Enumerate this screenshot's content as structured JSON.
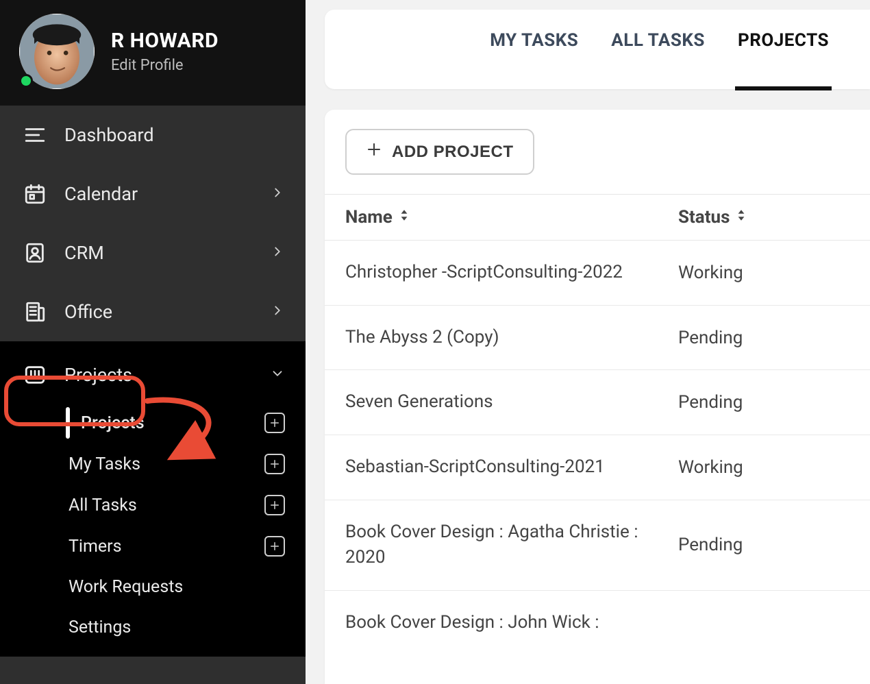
{
  "profile": {
    "name": "R HOWARD",
    "edit_label": "Edit Profile"
  },
  "sidebar": {
    "items": [
      {
        "label": "Dashboard"
      },
      {
        "label": "Calendar"
      },
      {
        "label": "CRM"
      },
      {
        "label": "Office"
      },
      {
        "label": "Projects"
      }
    ],
    "projects_sub": [
      {
        "label": "Projects",
        "has_add": true,
        "active": true
      },
      {
        "label": "My Tasks",
        "has_add": true
      },
      {
        "label": "All Tasks",
        "has_add": true
      },
      {
        "label": "Timers",
        "has_add": true
      },
      {
        "label": "Work Requests",
        "has_add": false
      },
      {
        "label": "Settings",
        "has_add": false
      }
    ]
  },
  "tabs": {
    "my_tasks": "MY TASKS",
    "all_tasks": "ALL TASKS",
    "projects": "PROJECTS"
  },
  "toolbar": {
    "add_project": "ADD PROJECT"
  },
  "table": {
    "headers": {
      "name": "Name",
      "status": "Status"
    },
    "rows": [
      {
        "name": "Christopher -ScriptConsulting-2022",
        "status": "Working"
      },
      {
        "name": "The Abyss 2 (Copy)",
        "status": "Pending"
      },
      {
        "name": "Seven Generations",
        "status": "Pending"
      },
      {
        "name": "Sebastian-ScriptConsulting-2021",
        "status": "Working"
      },
      {
        "name": "Book Cover Design : Agatha Christie : 2020",
        "status": "Pending"
      },
      {
        "name": "Book Cover Design : John Wick :",
        "status": ""
      }
    ]
  }
}
